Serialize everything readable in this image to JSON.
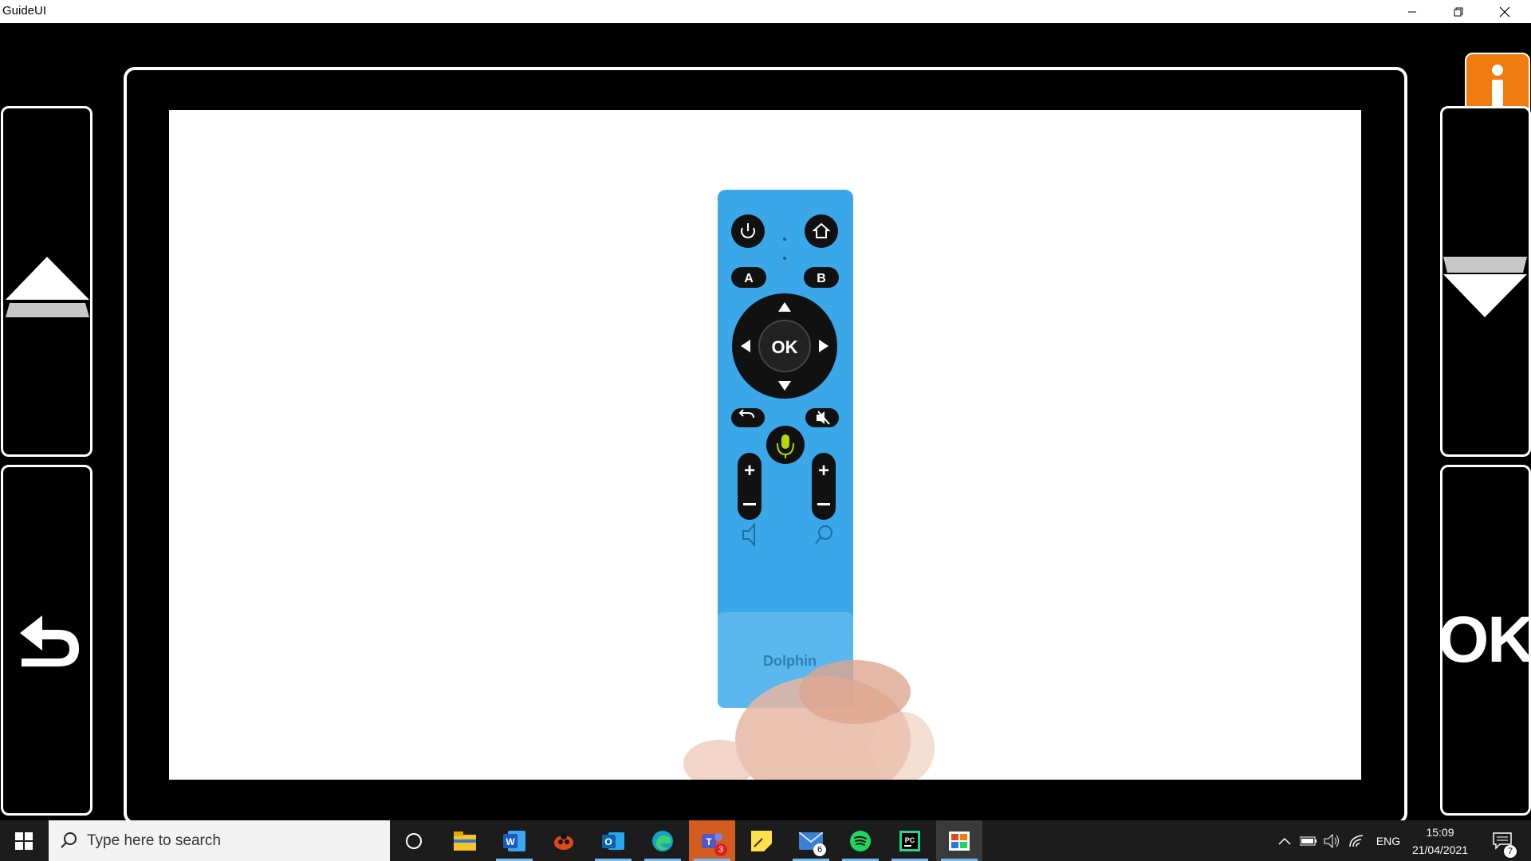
{
  "window": {
    "title": "GuideUI"
  },
  "app": {
    "info_label": "i",
    "ok_label": "OK",
    "remote": {
      "ok": "OK",
      "a": "A",
      "b": "B",
      "brand": "Dolphin"
    }
  },
  "taskbar": {
    "search_placeholder": "Type here to search",
    "teams_badge": "3",
    "mail_badge": "6",
    "language": "ENG",
    "time": "15:09",
    "date": "21/04/2021",
    "notifications_badge": "7"
  },
  "colors": {
    "accent_orange": "#f07c10",
    "remote_blue": "#3aa8e8",
    "taskbar": "#1c1c1c",
    "mic_green": "#b5d800"
  }
}
